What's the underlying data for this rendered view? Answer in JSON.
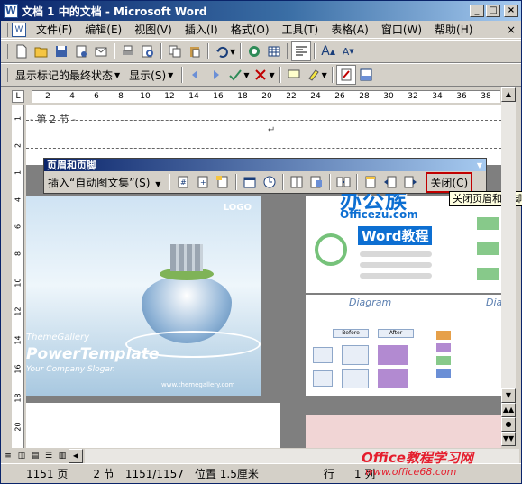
{
  "window": {
    "title": "文档 1 中的文档 - Microsoft Word",
    "controls": [
      "_",
      "□",
      "×"
    ]
  },
  "menu": {
    "items": [
      "文件(F)",
      "编辑(E)",
      "视图(V)",
      "插入(I)",
      "格式(O)",
      "工具(T)",
      "表格(A)",
      "窗口(W)",
      "帮助(H)"
    ],
    "close_doc": "×"
  },
  "toolbar2": {
    "markup_combo": "显示标记的最终状态",
    "show_label": "显示(S)"
  },
  "ruler": {
    "labels": [
      "2",
      "4",
      "6",
      "8",
      "10",
      "12",
      "14",
      "16",
      "18",
      "20",
      "22",
      "24",
      "26",
      "28",
      "30",
      "32",
      "34",
      "36",
      "38"
    ]
  },
  "vruler": {
    "labels": [
      "1",
      "2",
      "1",
      "4",
      "6",
      "8",
      "10",
      "12",
      "14",
      "16",
      "18",
      "20"
    ]
  },
  "document": {
    "section_label": "第 2 节",
    "para_mark": "↵"
  },
  "slide_left": {
    "logo": "LOGO",
    "gallery": "ThemeGallery",
    "title": "PowerTemplate",
    "slogan": "Your Company Slogan",
    "url": "www.themegallery.com"
  },
  "slide_right": {
    "diagram_title": "Diagram",
    "diagram_title2": "Diag",
    "before_label": "Before",
    "after_label": "After"
  },
  "watermark": {
    "line1": "办公族",
    "line2": "Officezu.com",
    "line3": "Word教程"
  },
  "hf_toolbar": {
    "title": "页眉和页脚",
    "insert_autotext": "插入“自动图文集”(S)",
    "close_button": "关闭(C)"
  },
  "tooltip": "关闭页眉和页脚",
  "statusbar": {
    "page": "1151 页",
    "section": "2 节",
    "page_of": "1151/1157",
    "position": "位置 1.5厘米",
    "row": "行",
    "col": "1 列"
  },
  "brand": {
    "line1": "Office教程学习网",
    "line2": "www.office68.com"
  }
}
